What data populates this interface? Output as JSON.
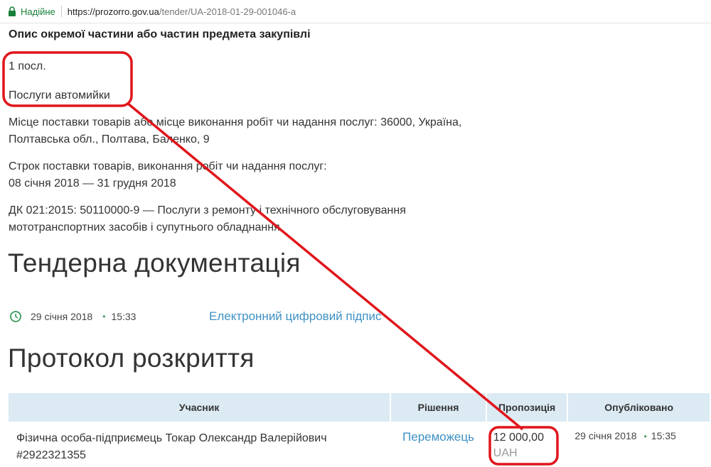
{
  "browser": {
    "secure_label": "Надійне",
    "url_host": "https://prozorro.gov.ua",
    "url_path": "/tender/UA-2018-01-29-001046-a",
    "secure_color": "#188038"
  },
  "lot": {
    "section_title": "Опис окремої частини або частин предмета закупівлі",
    "quantity": "1 посл.",
    "name": "Послуги автомийки",
    "delivery_place_line1": "Місце поставки товарів або місце виконання робіт чи надання послуг: 36000, Україна,",
    "delivery_place_line2": "Полтавська обл., Полтава, Баленко, 9",
    "delivery_term_label": "Строк поставки товарів, виконання робіт чи надання послуг:",
    "delivery_term_value": "08 січня 2018  —  31 грудня 2018",
    "classifier_line1": "ДК 021:2015: 50110000-9 — Послуги з ремонту і технічного обслуговування",
    "classifier_line2": "мототранспортних засобів і супутнього обладнання"
  },
  "documentation": {
    "heading": "Тендерна документація",
    "date": "29 січня 2018",
    "dot": "•",
    "time": "15:33",
    "link": "Електронний цифровий підпис",
    "icon": "clock-icon"
  },
  "protocol": {
    "heading": "Протокол розкриття",
    "columns": [
      "Учасник",
      "Рішення",
      "Пропозиція",
      "Опубліковано"
    ],
    "rows": [
      {
        "participant_line1": "Фізична особа-підприємець Токар Олександр Валерійович",
        "participant_line2": "#2922321355",
        "decision": "Переможець",
        "amount": "12 000,00",
        "currency": "UAH",
        "published_date": "29 січня 2018",
        "published_dot": "•",
        "published_time": "15:35"
      }
    ]
  },
  "colors": {
    "link": "#3e91c4",
    "table_header": "#dbeaf3",
    "annotation": "#e0151b",
    "accent_green": "#3a9a5b"
  }
}
